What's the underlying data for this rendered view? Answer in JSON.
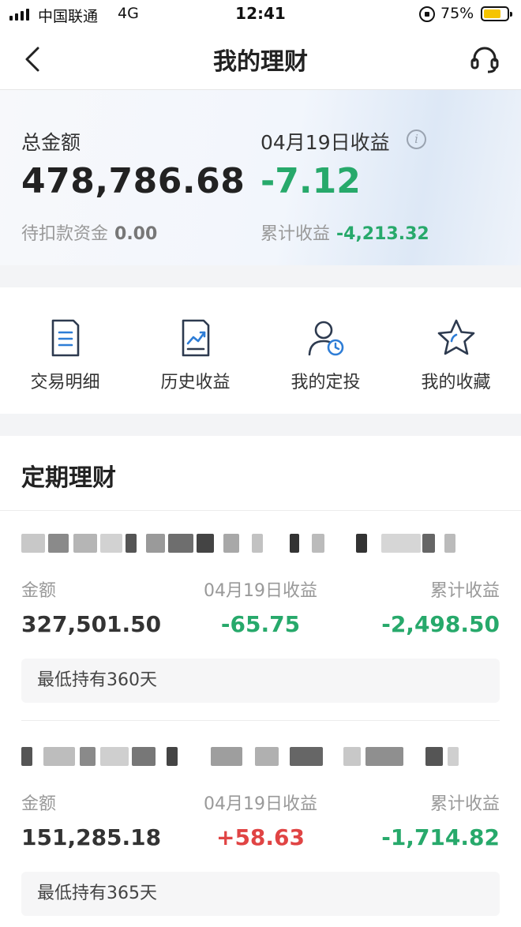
{
  "status_bar": {
    "carrier": "中国联通",
    "network": "4G",
    "time": "12:41",
    "battery_percent": "75%",
    "battery_level": 0.75
  },
  "nav": {
    "title": "我的理财",
    "back_icon": "chevron-left-icon",
    "service_icon": "headset-icon"
  },
  "summary": {
    "total_label": "总金额",
    "total_value": "478,786.68",
    "pending_label": "待扣款资金",
    "pending_value": "0.00",
    "daily_label": "04月19日收益",
    "daily_value": "-7.12",
    "cumulative_label": "累计收益",
    "cumulative_value": "-4,213.32"
  },
  "quick_actions": [
    {
      "label": "交易明细",
      "icon": "document-icon"
    },
    {
      "label": "历史收益",
      "icon": "chart-trend-icon"
    },
    {
      "label": "我的定投",
      "icon": "user-clock-icon"
    },
    {
      "label": "我的收藏",
      "icon": "star-icon"
    }
  ],
  "fixed_term": {
    "title": "定期理财",
    "products": [
      {
        "amount_label": "金额",
        "amount": "327,501.50",
        "daily_label": "04月19日收益",
        "daily": "-65.75",
        "cumulative_label": "累计收益",
        "cumulative": "-2,498.50",
        "holding": "最低持有360天"
      },
      {
        "amount_label": "金额",
        "amount": "151,285.18",
        "daily_label": "04月19日收益",
        "daily": "+58.63",
        "cumulative_label": "累计收益",
        "cumulative": "-1,714.82",
        "holding": "最低持有365天"
      }
    ]
  },
  "colors": {
    "gain_negative": "#27a96b",
    "gain_positive": "#e04444",
    "battery": "#f5c400"
  }
}
